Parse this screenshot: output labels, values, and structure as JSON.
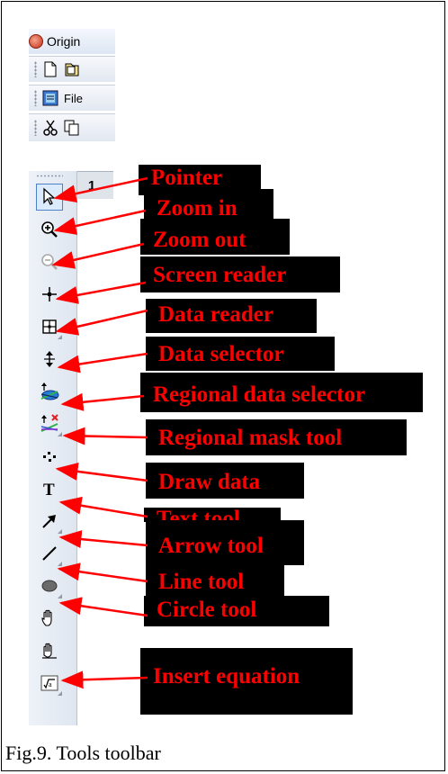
{
  "app": {
    "title": "Origin"
  },
  "toolbars": [
    {
      "icons": [
        "new-document-icon",
        "open-document-icon"
      ]
    },
    {
      "icons": [
        "file-icon"
      ],
      "label": "File"
    },
    {
      "icons": [
        "cut-icon",
        "copy-icon"
      ]
    }
  ],
  "tab": {
    "label": "1"
  },
  "tools": [
    {
      "icon": "pointer-icon",
      "label": "Pointer",
      "selected": true
    },
    {
      "icon": "zoom-in-icon",
      "label": "Zoom in"
    },
    {
      "icon": "zoom-out-icon",
      "label": "Zoom out",
      "disabled": true
    },
    {
      "icon": "screen-reader-icon",
      "label": "Screen reader"
    },
    {
      "icon": "data-reader-icon",
      "label": "Data reader"
    },
    {
      "icon": "data-selector-icon",
      "label": "Data selector"
    },
    {
      "icon": "regional-data-selector-icon",
      "label": "Regional data selector"
    },
    {
      "icon": "regional-mask-tool-icon",
      "label": "Regional mask tool"
    },
    {
      "icon": "draw-data-icon",
      "label": "Draw data"
    },
    {
      "icon": "text-tool-icon",
      "label": "Text tool"
    },
    {
      "icon": "arrow-tool-icon",
      "label": "Arrow tool"
    },
    {
      "icon": "line-tool-icon",
      "label": "Line tool"
    },
    {
      "icon": "circle-tool-icon",
      "label": "Circle tool"
    },
    {
      "icon": "hand-icon",
      "label": ""
    },
    {
      "icon": "hand-scroll-icon",
      "label": ""
    },
    {
      "icon": "insert-equation-icon",
      "label": "Insert equation"
    }
  ],
  "labels": {
    "pointer": "Pointer",
    "zoom_in": "Zoom in",
    "zoom_out": "Zoom out",
    "screen_reader": "Screen reader",
    "data_reader": "Data reader",
    "data_selector": "Data selector",
    "regional_data_selector": "Regional data selector",
    "regional_mask_tool": "Regional mask tool",
    "draw_data": "Draw data",
    "text_tool": "Text tool",
    "arrow_tool": "Arrow tool",
    "line_tool": "Line tool",
    "circle_tool": "Circle tool",
    "insert_equation": "Insert equation"
  },
  "colors": {
    "label_text": "#ff0000",
    "label_bg": "#000000",
    "arrow": "#ff0000"
  },
  "caption": "Fig.9. Tools toolbar"
}
